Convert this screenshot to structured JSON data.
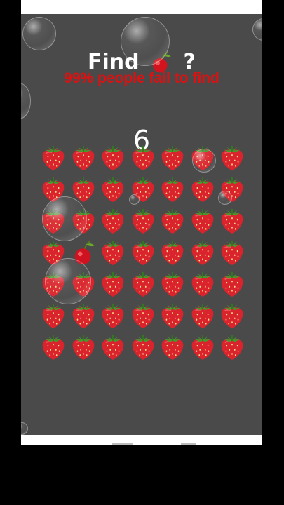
{
  "header": {
    "title_word": "Find",
    "title_question": "?",
    "target_icon": "cherry-icon",
    "subtitle": "99% people fail to find"
  },
  "timer": {
    "value": "6"
  },
  "grid": {
    "rows": 7,
    "cols": 7,
    "item_icon": "strawberry-icon",
    "odd_icon": "cherry-icon",
    "odd_cell": {
      "row": 3,
      "col": 1
    }
  },
  "colors": {
    "background": "#4a4a4a",
    "subtitle": "#dd1111",
    "title": "#ffffff"
  }
}
